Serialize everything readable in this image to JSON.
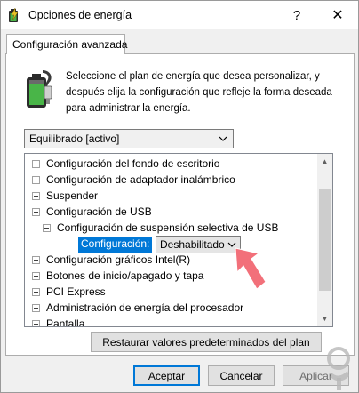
{
  "window": {
    "title": "Opciones de energía",
    "help_glyph": "?",
    "close_glyph": "✕"
  },
  "tab": {
    "label": "Configuración avanzada"
  },
  "description": "Seleccione el plan de energía que desea personalizar, y después elija la configuración que refleje la forma deseada para administrar la energía.",
  "plan_select": {
    "value": "Equilibrado [activo]"
  },
  "tree": {
    "items": [
      {
        "label": "Configuración del fondo de escritorio"
      },
      {
        "label": "Configuración de adaptador inalámbrico"
      },
      {
        "label": "Suspender"
      },
      {
        "label": "Configuración de USB"
      },
      {
        "label": "Configuración de suspensión selectiva de USB"
      },
      {
        "label": "Configuración gráficos Intel(R)"
      },
      {
        "label": "Botones de inicio/apagado y tapa"
      },
      {
        "label": "PCI Express"
      },
      {
        "label": "Administración de energía del procesador"
      },
      {
        "label": "Pantalla"
      }
    ],
    "setting": {
      "label": "Configuración:",
      "value": "Deshabilitado"
    }
  },
  "buttons": {
    "restore": "Restaurar valores predeterminados del plan",
    "ok": "Aceptar",
    "cancel": "Cancelar",
    "apply": "Aplicar"
  },
  "colors": {
    "selection": "#0078d7",
    "annotation_arrow": "#f2707a"
  },
  "icons": {
    "title": "power-options-icon",
    "battery": "battery-plan-icon"
  }
}
